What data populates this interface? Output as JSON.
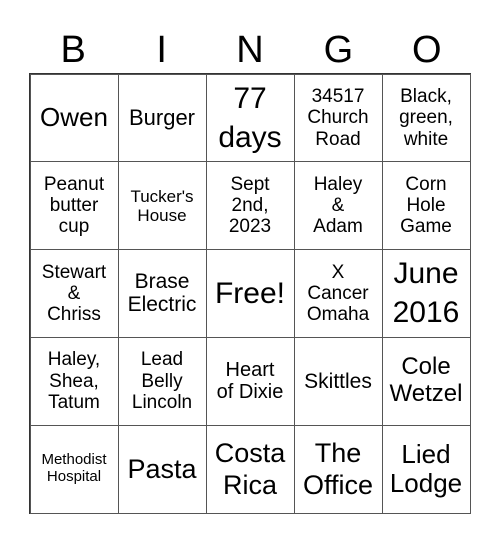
{
  "header": [
    "B",
    "I",
    "N",
    "G",
    "O"
  ],
  "cells": [
    "Owen",
    "Burger",
    "77\ndays",
    "34517\nChurch\nRoad",
    "Black,\ngreen,\nwhite",
    "Peanut\nbutter\ncup",
    "Tucker's\nHouse",
    "Sept\n2nd,\n2023",
    "Haley\n&\nAdam",
    "Corn\nHole\nGame",
    "Stewart\n&\nChriss",
    "Brase\nElectric",
    "Free!",
    "X\nCancer\nOmaha",
    "June\n2016",
    "Haley,\nShea,\nTatum",
    "Lead\nBelly\nLincoln",
    "Heart\nof Dixie",
    "Skittles",
    "Cole\nWetzel",
    "Methodist\nHospital",
    "Pasta",
    "Costa\nRica",
    "The\nOffice",
    "Lied\nLodge"
  ]
}
